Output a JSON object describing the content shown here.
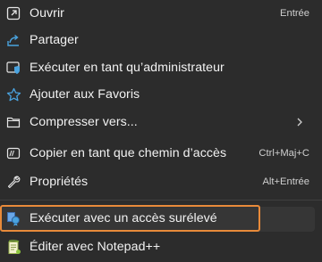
{
  "menu": {
    "items": [
      {
        "label": "Ouvrir",
        "shortcut": "Entrée",
        "icon": "open-icon"
      },
      {
        "label": "Partager",
        "shortcut": "",
        "icon": "share-icon"
      },
      {
        "label": "Exécuter en tant qu’administrateur",
        "shortcut": "",
        "icon": "run-as-admin-icon"
      },
      {
        "label": "Ajouter aux Favoris",
        "shortcut": "",
        "icon": "star-icon"
      },
      {
        "label": "Compresser vers...",
        "shortcut": "",
        "icon": "zip-folder-icon",
        "submenu": true
      },
      {
        "label": "Copier en tant que chemin d’accès",
        "shortcut": "Ctrl+Maj+C",
        "icon": "copy-path-icon"
      },
      {
        "label": "Propriétés",
        "shortcut": "Alt+Entrée",
        "icon": "wrench-icon"
      },
      {
        "label": "Exécuter avec un accès surélevé",
        "shortcut": "",
        "icon": "elevated-run-icon",
        "highlighted": true
      },
      {
        "label": "Éditer avec Notepad++",
        "shortcut": "",
        "icon": "notepad-plus-plus-icon"
      }
    ]
  },
  "colors": {
    "background": "#2c2c2c",
    "highlight_border": "#e88a3a",
    "accent_blue": "#4aa3df"
  }
}
